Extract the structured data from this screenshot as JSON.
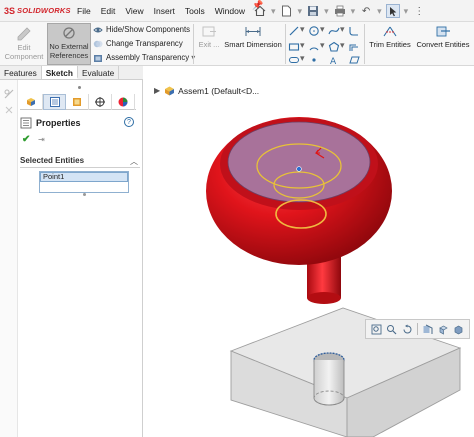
{
  "app": {
    "logo_mark": "3S",
    "logo_text": "SOLIDWORKS"
  },
  "menu": {
    "items": [
      "File",
      "Edit",
      "View",
      "Insert",
      "Tools",
      "Window"
    ]
  },
  "ribbon": {
    "edit_component_line1": "Edit",
    "edit_component_line2": "Component",
    "no_external_refs_line1": "No External",
    "no_external_refs_line2": "References",
    "hide_show_components": "Hide/Show Components",
    "change_transparency": "Change Transparency",
    "assembly_transparency": "Assembly Transparency",
    "exit_sketch": "Exit ...",
    "smart_dimension": "Smart Dimension",
    "trim_entities": "Trim Entities",
    "convert_entities": "Convert Entities"
  },
  "command_tabs": [
    "Features",
    "Sketch",
    "Evaluate"
  ],
  "active_command_tab": "Sketch",
  "property_manager": {
    "title": "Properties",
    "help": "?",
    "selected_entities_label": "Selected Entities",
    "selected_items": [
      "Point1"
    ]
  },
  "tree": {
    "root_label": "Assem1  (Default<D..."
  },
  "colors": {
    "knob_red": "#e0141b",
    "knob_dark": "#9c0a0f",
    "face_purple": "#a8729a",
    "sketch_yellow": "#e8c237",
    "block_grey": "#dcdcdc",
    "selection_blue": "#d4e4f5",
    "logo_red": "#d2232a"
  },
  "icons": {
    "hud": [
      "zoom-fit-icon",
      "zoom-area-icon",
      "previous-view-icon",
      "section-view-icon",
      "view-orientation-icon",
      "display-style-icon"
    ]
  }
}
